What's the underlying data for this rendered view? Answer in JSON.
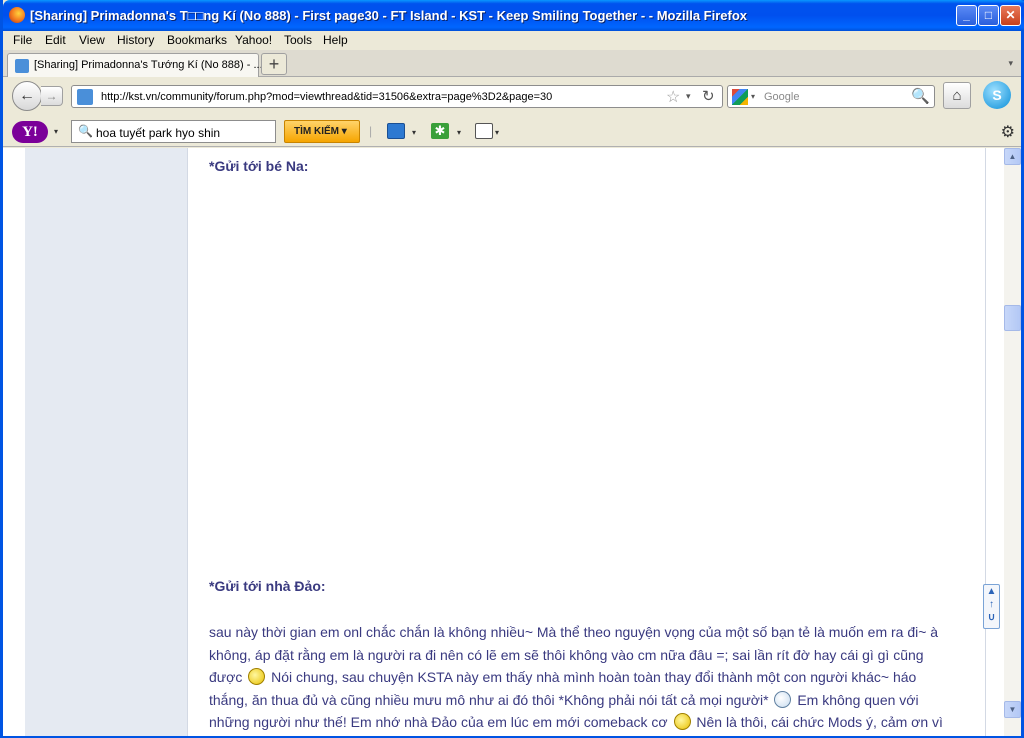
{
  "window": {
    "title": "[Sharing] Primadonna's T□□ng Kí (No 888) - First page30 - FT Island - KST - Keep Smiling Together - - Mozilla Firefox",
    "controls": {
      "minimize": "_",
      "maximize": "□",
      "close": "✕"
    }
  },
  "menu": {
    "items": [
      "File",
      "Edit",
      "View",
      "History",
      "Bookmarks",
      "Yahoo!",
      "Tools",
      "Help"
    ]
  },
  "tabs": {
    "active_label": "[Sharing] Primadonna's Tướng Kí (No 888) - ...",
    "new_tab": "+",
    "list_arrow": "▾"
  },
  "nav": {
    "back": "←",
    "forward": "→",
    "url": "http://kst.vn/community/forum.php?mod=viewthread&tid=31506&extra=page%3D2&page=30",
    "star": "☆",
    "reload": "↻",
    "search_placeholder": "Google",
    "search_icon": "🔍",
    "home": "⌂",
    "skype": "S"
  },
  "yahoo": {
    "logo": "Y!",
    "query": "hoa tuyết park hyo shin",
    "search_button": "TÌM KIẾM",
    "dropdown": "▾",
    "gear": "⚙",
    "asterisk": "✱"
  },
  "content": {
    "heading1": "*Gửi tới bé Na:",
    "heading2": "*Gửi tới nhà Đảo:",
    "para_parts": [
      "sau này thời gian em onl chắc chắn là không nhiều~ Mà thể theo nguyện vọng của một số bạn tẻ là muốn em ra đi~ à không, áp đặt rằng em là người ra đi nên có lẽ em sẽ thôi không vào cm nữa đâu =; sai lần rít đờ hay cái gì gì cũng được",
      " Nói chung, sau chuyện KSTA này em thấy nhà mình hoàn toàn thay đổi thành một con người khác~ háo thắng, ăn thua đủ và cũng nhiều mưu mô như ai đó thôi *Không phải nói tất cả mọi người*",
      " Em không quen với những người như thế! Em nhớ nhà Đảo của em lúc em mới comeback cơ",
      "  Nên là thôi, cái chức Mods ý, cảm ơn vì ss Ngô đã giao"
    ],
    "totop_label": "TOP"
  },
  "scrollbar": {
    "up": "▲",
    "down": "▼"
  }
}
